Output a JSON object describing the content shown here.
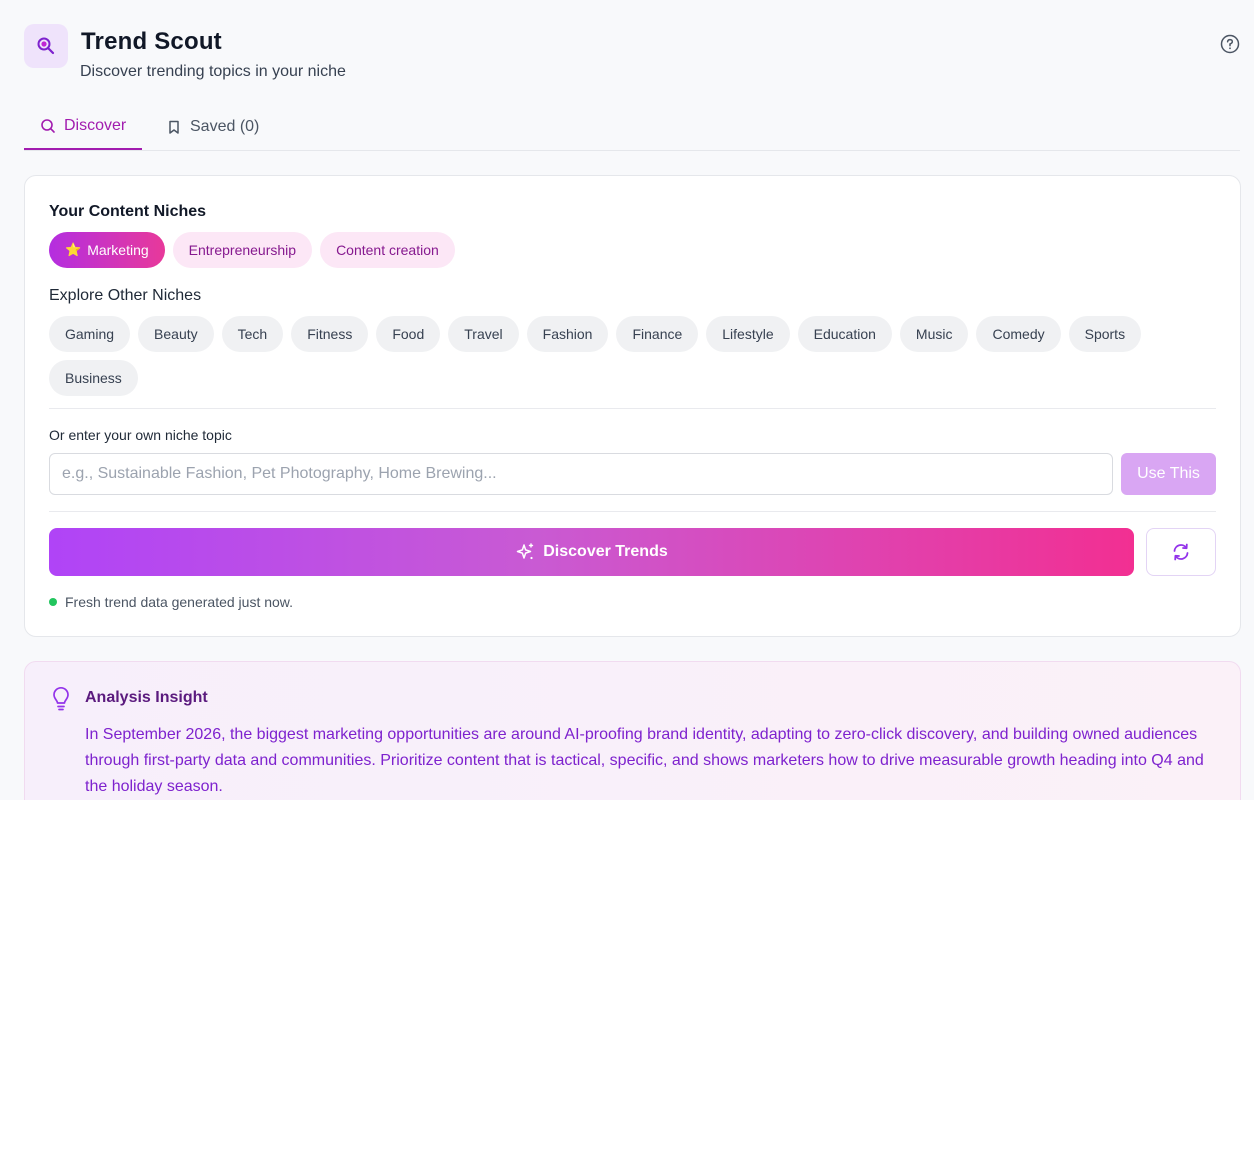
{
  "header": {
    "title": "Trend Scout",
    "subtitle": "Discover trending topics in your niche"
  },
  "tabs": [
    {
      "label": "Discover",
      "active": true,
      "icon": "search-icon"
    },
    {
      "label": "Saved (0)",
      "active": false,
      "icon": "bookmark-icon"
    }
  ],
  "niches": {
    "title": "Your Content Niches",
    "mine": [
      {
        "label": "Marketing",
        "active": true,
        "icon": "⭐"
      },
      {
        "label": "Entrepreneurship",
        "active": false
      },
      {
        "label": "Content creation",
        "active": false
      }
    ],
    "explore_title": "Explore Other Niches",
    "other": [
      "Gaming",
      "Beauty",
      "Tech",
      "Fitness",
      "Food",
      "Travel",
      "Fashion",
      "Finance",
      "Lifestyle",
      "Education",
      "Music",
      "Comedy",
      "Sports",
      "Business"
    ]
  },
  "custom": {
    "label": "Or enter your own niche topic",
    "placeholder": "e.g., Sustainable Fashion, Pet Photography, Home Brewing...",
    "value": "",
    "button": "Use This"
  },
  "actions": {
    "discover_label": "Discover Trends",
    "status": "Fresh trend data generated just now."
  },
  "insight": {
    "title": "Analysis Insight",
    "body": "In September 2026, the biggest marketing opportunities are around AI-proofing brand identity, adapting to zero-click discovery, and building owned audiences through first-party data and communities. Prioritize content that is tactical, specific, and shows marketers how to drive measurable growth heading into Q4 and the holiday season."
  },
  "colors": {
    "accent": "#a21caf",
    "gradient_start": "#b044f7",
    "gradient_end": "#f22f92",
    "status_dot": "#22c55e"
  }
}
